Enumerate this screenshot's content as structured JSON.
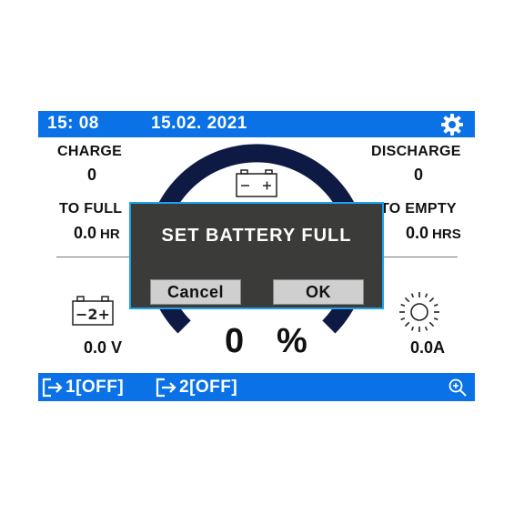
{
  "header": {
    "time": "15: 08",
    "date": "15.02. 2021"
  },
  "charge": {
    "label": "CHARGE",
    "value": "0"
  },
  "discharge": {
    "label": "DISCHARGE",
    "value": "0"
  },
  "to_full": {
    "label": "TO FULL",
    "value": "0.0",
    "unit": "HR"
  },
  "to_empty": {
    "label": "TO EMPTY",
    "value": "0.0",
    "unit": "HRS"
  },
  "battery_percent": {
    "value": "0",
    "symbol": "%"
  },
  "voltage": "0.0 V",
  "current": "0.0A",
  "battery2_label": "−2+",
  "battery_top_label": "− +",
  "outputs": [
    {
      "label": "1[OFF]"
    },
    {
      "label": "2[OFF]"
    }
  ],
  "dialog": {
    "title": "SET BATTERY FULL",
    "cancel_label": "Cancel",
    "ok_label": "OK"
  },
  "colors": {
    "bar": "#0a72e6",
    "gauge": "#0e1a44",
    "dialog_bg": "#3b3b39",
    "dialog_border": "#1aa3f0"
  },
  "icons": {
    "settings": "gear-icon",
    "output": "output-arrow-icon",
    "zoom": "zoom-in-icon",
    "sun": "sun-icon",
    "battery": "battery-icon"
  }
}
